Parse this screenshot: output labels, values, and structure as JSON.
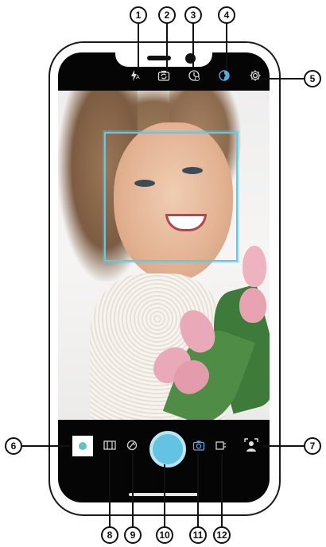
{
  "callouts": {
    "c1": "1",
    "c2": "2",
    "c3": "3",
    "c4": "4",
    "c5": "5",
    "c6": "6",
    "c7": "7",
    "c8": "8",
    "c9": "9",
    "c10": "10",
    "c11": "11",
    "c12": "12"
  },
  "top_bar": {
    "flash_icon": "flash-auto-icon",
    "flip_icon": "flip-camera-icon",
    "timer_icon": "timer-icon",
    "hdr_icon": "hdr-icon",
    "settings_icon": "gear-icon",
    "flash_suffix": "A"
  },
  "bottom_bar": {
    "gallery": "gallery-thumbnail",
    "filter_icon": "filter-icon",
    "beauty_icon": "beauty-icon",
    "shutter": "shutter-button",
    "camera_mode_icon": "camera-mode-icon",
    "aspect_icon": "aspect-ratio-icon",
    "portrait_icon": "portrait-mode-icon"
  },
  "colors": {
    "accent": "#64c3e3",
    "face_box": "#66c7e5",
    "hdr_active": "#5aa7d8"
  }
}
